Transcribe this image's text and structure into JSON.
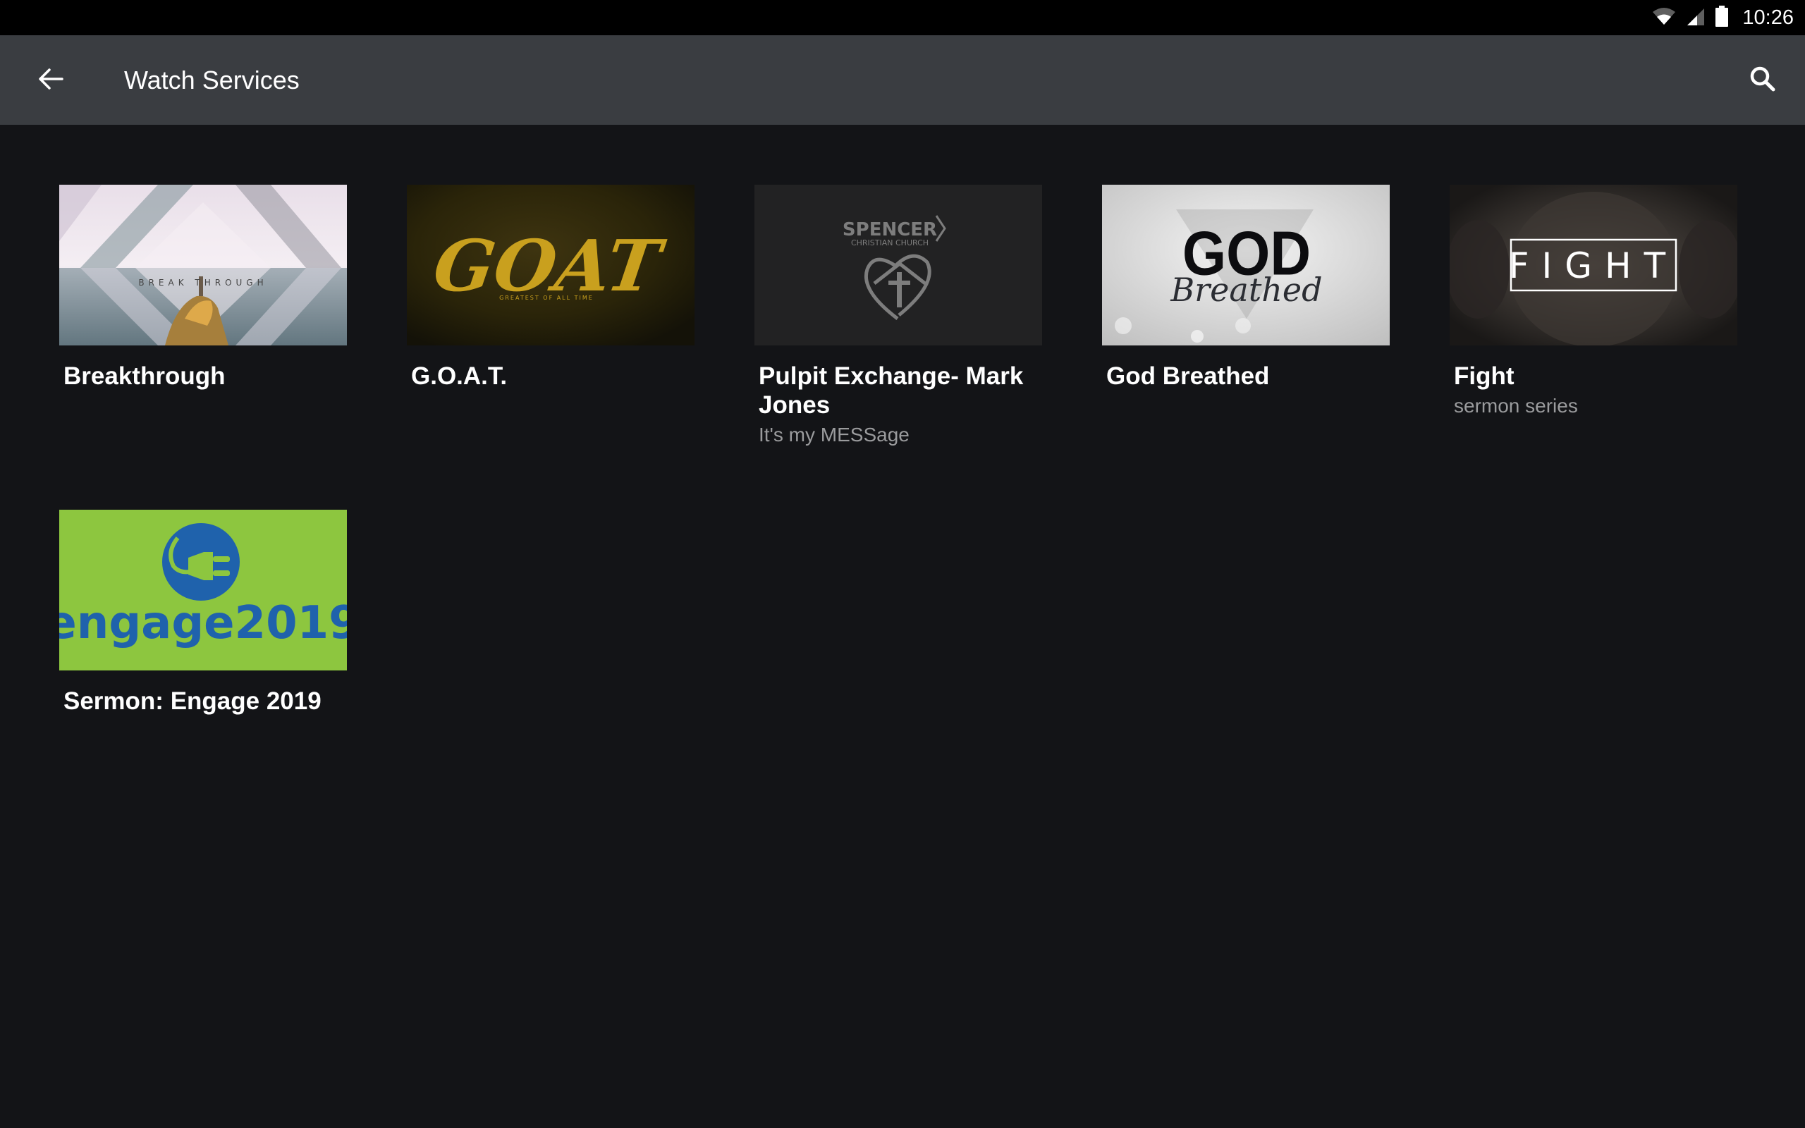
{
  "status_bar": {
    "time": "10:26",
    "icons": [
      "wifi-icon",
      "cell-signal-icon",
      "battery-icon"
    ]
  },
  "app_bar": {
    "title": "Watch Services",
    "back_icon": "arrow-left-icon",
    "search_icon": "search-icon",
    "background": "#3a3d41"
  },
  "items": [
    {
      "title": "Breakthrough",
      "subtitle": "",
      "thumbnail": {
        "label": "BREAK THROUGH",
        "style": "misty-sea-diamond"
      }
    },
    {
      "title": "G.O.A.T.",
      "subtitle": "",
      "thumbnail": {
        "label": "GOAT",
        "tagline": "GREATEST OF ALL TIME",
        "style": "gold-on-dark"
      }
    },
    {
      "title": "Pulpit Exchange- Mark Jones",
      "subtitle": "It's my MESSage",
      "thumbnail": {
        "label": "SPENCER",
        "tagline": "CHRISTIAN CHURCH",
        "style": "gray-church-logo"
      }
    },
    {
      "title": "God Breathed",
      "subtitle": "",
      "thumbnail": {
        "label": "GOD",
        "tagline": "Breathed",
        "style": "gray-clouds"
      }
    },
    {
      "title": "Fight",
      "subtitle": "sermon series",
      "thumbnail": {
        "label": "FIGHT",
        "style": "dark-lion"
      }
    },
    {
      "title": "Sermon: Engage 2019",
      "subtitle": "",
      "thumbnail": {
        "label": "engage2019",
        "style": "green-plug",
        "bg": "#8dc63f",
        "fg": "#1f62ac"
      }
    }
  ],
  "colors": {
    "background": "#131417",
    "title_text": "#ffffff",
    "subtitle_text": "#9a9b9d"
  }
}
